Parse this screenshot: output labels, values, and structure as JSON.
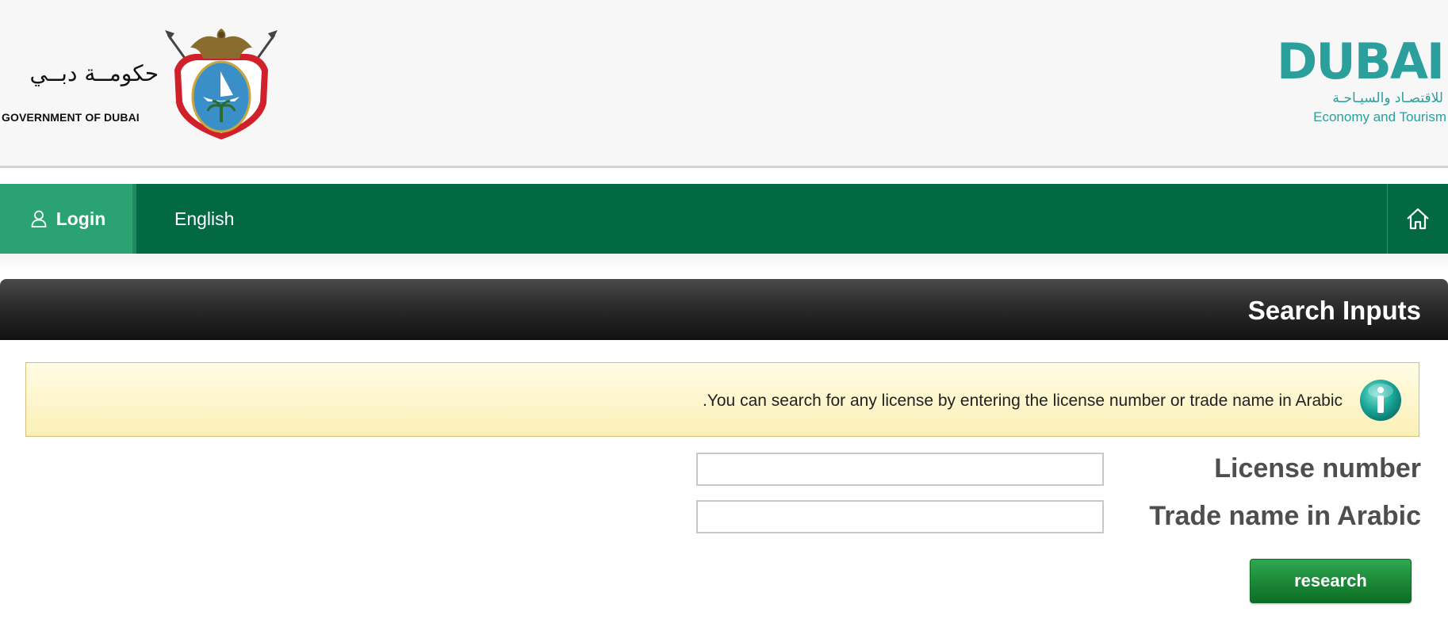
{
  "header": {
    "gov_arabic": "حكومــة دبــي",
    "gov_english": "GOVERNMENT OF DUBAI",
    "dubai_word": "DUBAI",
    "dubai_arabic": "للاقتصـاد والسيـاحـة",
    "dubai_english": "Economy and Tourism"
  },
  "nav": {
    "login_label": "Login",
    "language_label": "English",
    "icons": [
      "user-icon",
      "home-icon"
    ]
  },
  "section": {
    "title": "Search Inputs"
  },
  "notice": {
    "text": ".You can search for any license by entering the license number or trade name in Arabic",
    "icon": "info-icon"
  },
  "form": {
    "license_label": "License number",
    "license_value": "",
    "trade_label": "Trade name in Arabic",
    "trade_value": "",
    "submit_label": "research"
  },
  "colors": {
    "nav_green": "#026944",
    "login_green": "#2aa272",
    "brand_teal": "#2a9f9c",
    "button_green": "#1c8a39",
    "notice_yellow": "#fbf0b8"
  }
}
